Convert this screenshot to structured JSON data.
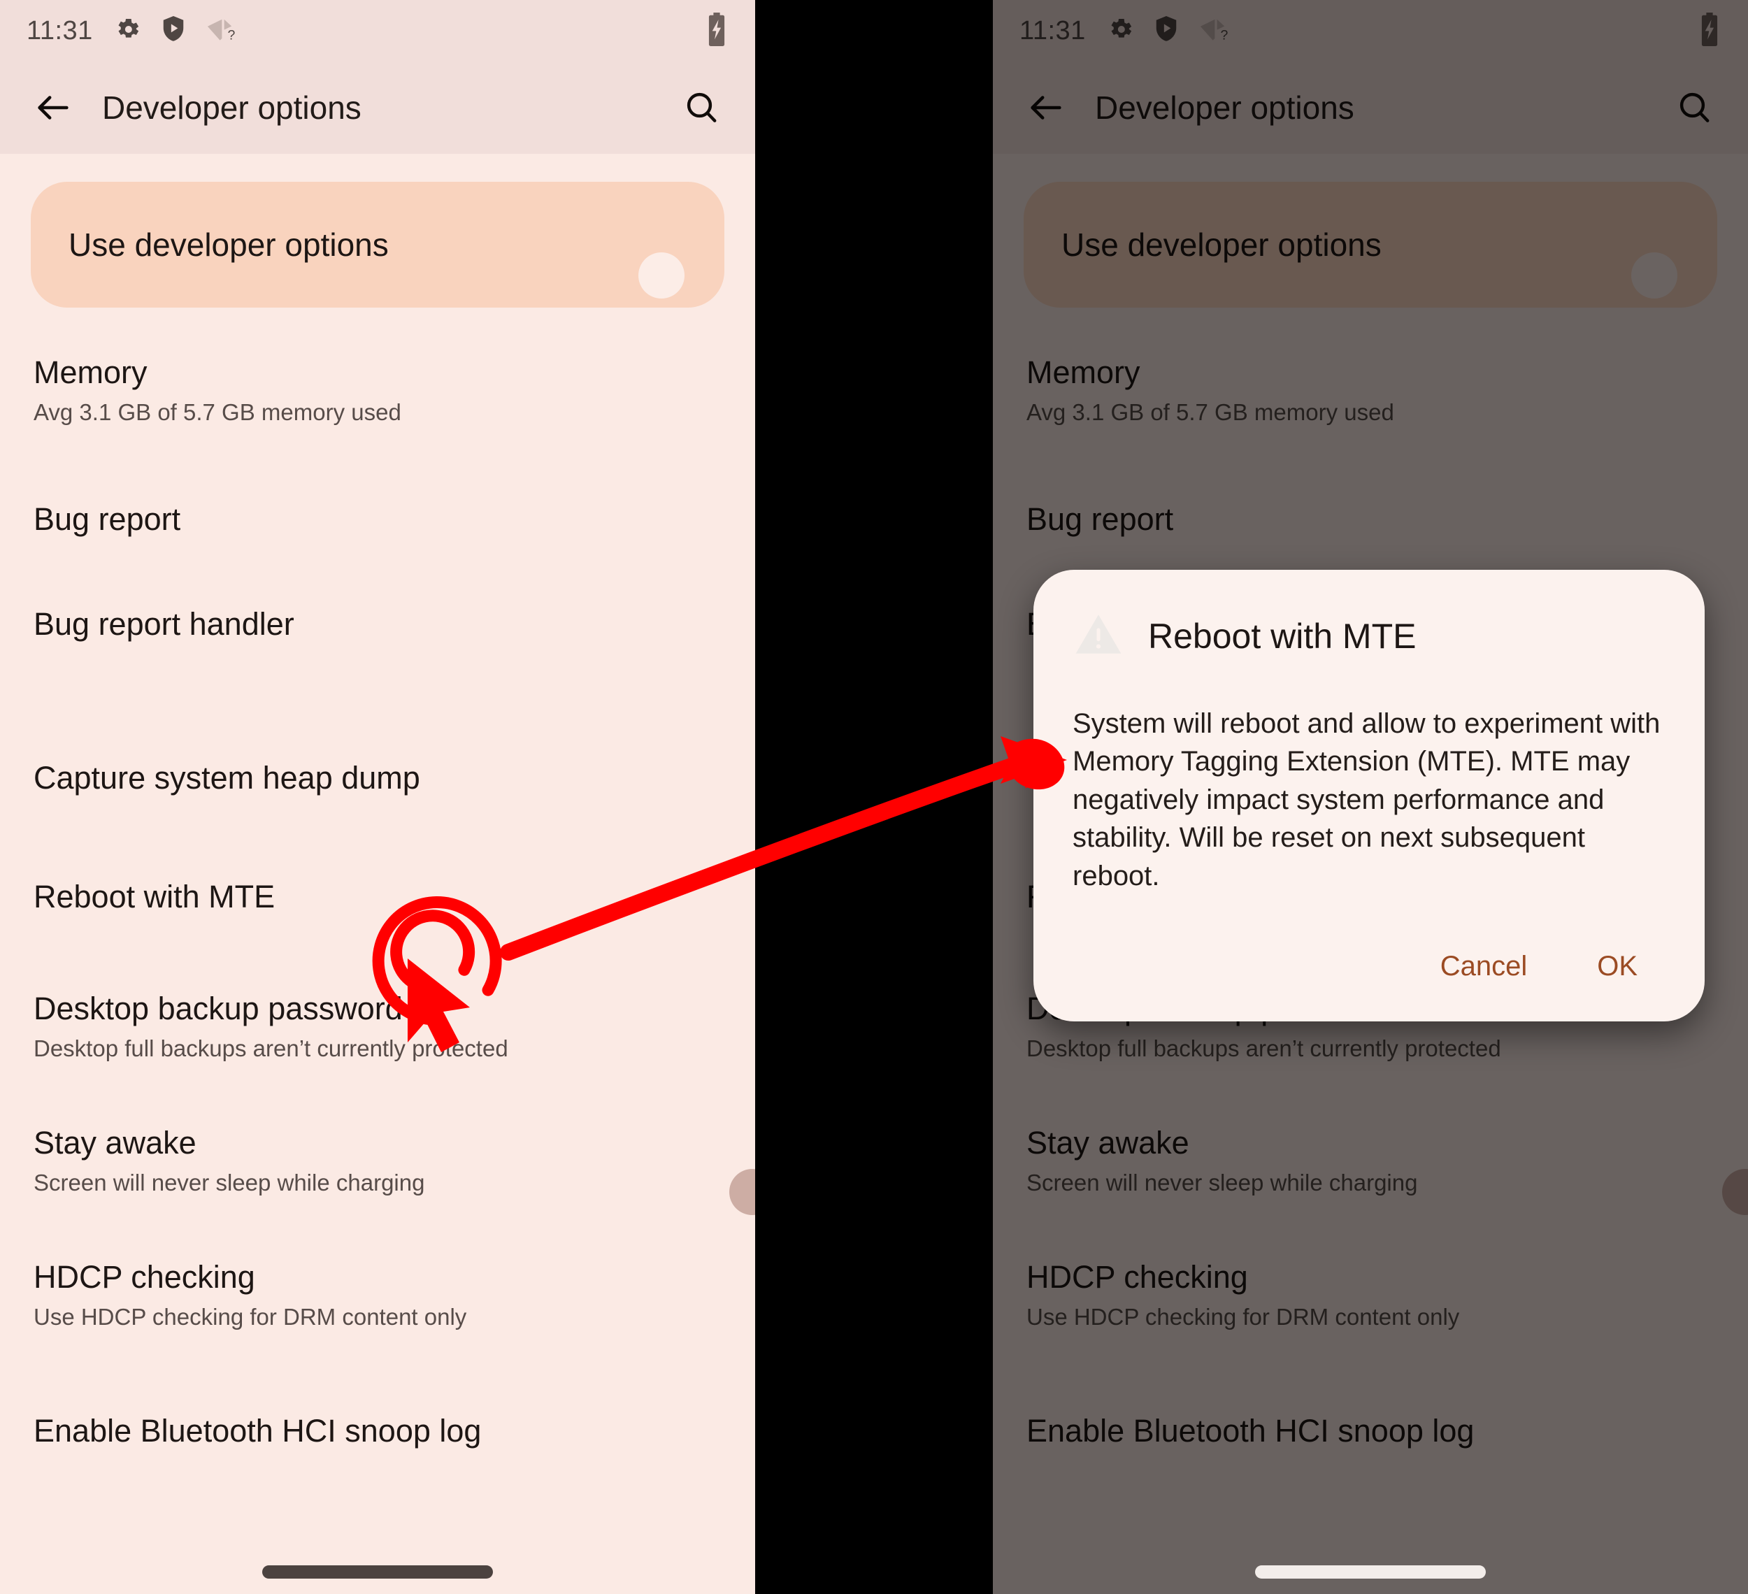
{
  "status_bar": {
    "time": "11:31",
    "icons": [
      "gear-icon",
      "shield-play-icon",
      "wifi-question-icon"
    ],
    "battery_icon": "battery-charging-icon"
  },
  "app_bar": {
    "back_icon": "back-arrow-icon",
    "title": "Developer options",
    "search_icon": "search-icon"
  },
  "master_switch": {
    "label": "Use developer options",
    "state": "on"
  },
  "list_items": [
    {
      "title": "Memory",
      "subtitle": "Avg 3.1 GB of 5.7 GB memory used",
      "control": "none"
    },
    {
      "title": "Bug report",
      "subtitle": "",
      "control": "none"
    },
    {
      "title": "Bug report handler",
      "subtitle": "",
      "control": "none"
    },
    {
      "title": "Capture system heap dump",
      "subtitle": "",
      "control": "none"
    },
    {
      "title": "Reboot with MTE",
      "subtitle": "",
      "control": "none"
    },
    {
      "title": "Desktop backup password",
      "subtitle": "Desktop full backups aren’t currently protected",
      "control": "none"
    },
    {
      "title": "Stay awake",
      "subtitle": "Screen will never sleep while charging",
      "control": "switch-off"
    },
    {
      "title": "HDCP checking",
      "subtitle": "Use HDCP checking for DRM content only",
      "control": "none"
    },
    {
      "title": "Enable Bluetooth HCI snoop log",
      "subtitle": "",
      "control": "none"
    }
  ],
  "dialog": {
    "icon": "warning-triangle-icon",
    "title": "Reboot with MTE",
    "body": "System will reboot and allow to experiment with Memory Tagging Extension (MTE). MTE may negatively impact system performance and stability. Will be reset on next subsequent reboot.",
    "cancel_label": "Cancel",
    "ok_label": "OK"
  },
  "annotations": {
    "click_target_icon": "click-cursor-icon",
    "flow_arrow_icon": "curved-arrow-icon",
    "color": "#FF0000"
  },
  "colors": {
    "surface": "#FBEAE4",
    "status_bar": "#F1DEDA",
    "master_card": "#F9D3BE",
    "switch_on": "#8C4726",
    "switch_off": "#7B6763",
    "accent": "#9B4B23",
    "dialog_surface": "#FCF2EE",
    "scrim": "rgba(0,0,0,0.58)"
  }
}
